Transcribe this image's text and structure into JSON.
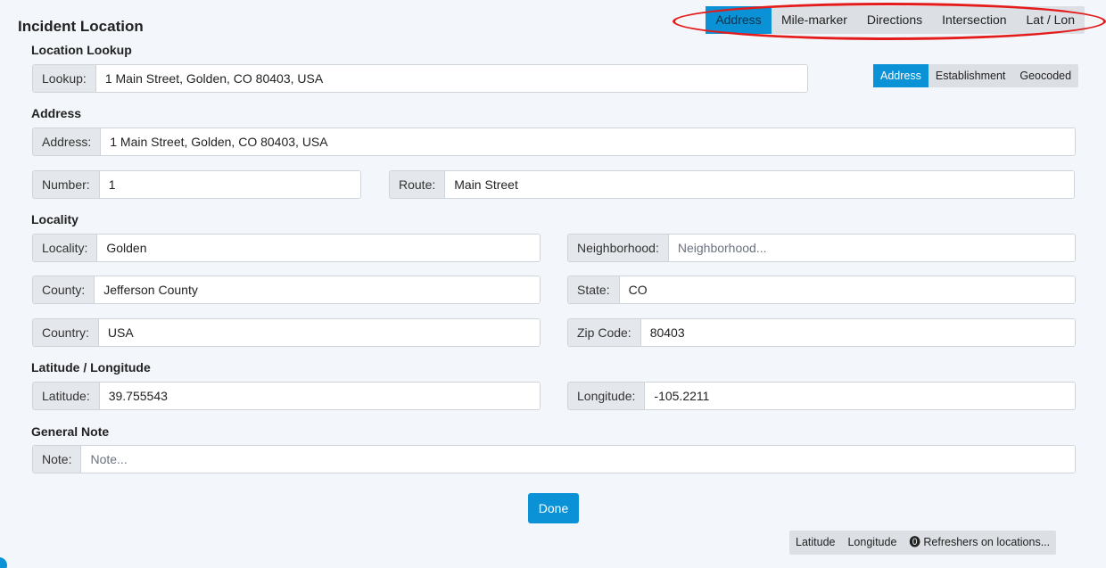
{
  "page": {
    "title": "Incident Location"
  },
  "mode_tabs": [
    {
      "label": "Address",
      "active": true
    },
    {
      "label": "Mile-marker",
      "active": false
    },
    {
      "label": "Directions",
      "active": false
    },
    {
      "label": "Intersection",
      "active": false
    },
    {
      "label": "Lat / Lon",
      "active": false
    }
  ],
  "sections": {
    "lookup": "Location Lookup",
    "address": "Address",
    "locality": "Locality",
    "latlon": "Latitude / Longitude",
    "note": "General Note"
  },
  "lookup": {
    "label": "Lookup:",
    "value": "1 Main Street, Golden, CO 80403, USA",
    "sources": [
      {
        "label": "Address",
        "active": true
      },
      {
        "label": "Establishment",
        "active": false
      },
      {
        "label": "Geocoded",
        "active": false
      }
    ]
  },
  "address": {
    "address_label": "Address:",
    "address_value": "1 Main Street, Golden, CO 80403, USA",
    "number_label": "Number:",
    "number_value": "1",
    "route_label": "Route:",
    "route_value": "Main Street"
  },
  "locality": {
    "locality_label": "Locality:",
    "locality_value": "Golden",
    "neighborhood_label": "Neighborhood:",
    "neighborhood_placeholder": "Neighborhood...",
    "county_label": "County:",
    "county_value": "Jefferson County",
    "state_label": "State:",
    "state_value": "CO",
    "country_label": "Country:",
    "country_value": "USA",
    "zip_label": "Zip Code:",
    "zip_value": "80403"
  },
  "latlon": {
    "lat_label": "Latitude:",
    "lat_value": "39.755543",
    "lon_label": "Longitude:",
    "lon_value": "-105.2211"
  },
  "note": {
    "label": "Note:",
    "placeholder": "Note..."
  },
  "actions": {
    "done": "Done"
  },
  "references": {
    "latitude": "Latitude",
    "longitude": "Longitude",
    "refreshers": "⓿ Refreshers on locations..."
  },
  "colors": {
    "accent": "#0b92d6",
    "highlight": "#e41b1b",
    "background": "#f3f6fa"
  }
}
